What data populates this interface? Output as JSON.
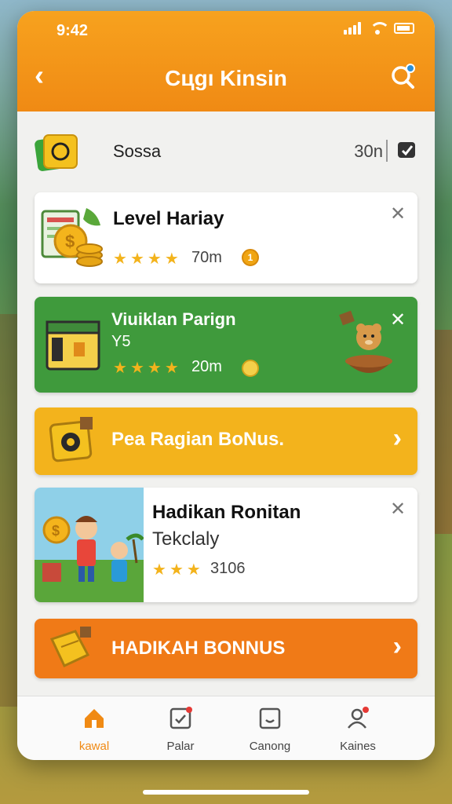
{
  "status": {
    "time": "9:42"
  },
  "header": {
    "title": "Cцgı Kinsin"
  },
  "top_row": {
    "label": "Sossa",
    "count": "30n"
  },
  "cards": [
    {
      "title": "Level Hariay",
      "stars": 4,
      "value": "70m",
      "coin_text": "1"
    },
    {
      "title": "Viuiklan Parign",
      "subtitle": "Y5",
      "stars": 4,
      "value": "20m"
    },
    {
      "title": "Pea Ragian BoNus."
    },
    {
      "title": "Hadikan Ronitan",
      "subtitle": "Tekclaly",
      "stars": 3,
      "value": "3106"
    },
    {
      "title": "HADIKAH BONNUS"
    }
  ],
  "nav": [
    {
      "label": "kawal",
      "active": true
    },
    {
      "label": "Palar"
    },
    {
      "label": "Canong"
    },
    {
      "label": "Kaines"
    }
  ],
  "colors": {
    "orange": "#f08a14",
    "green": "#3f9a3c",
    "yellow": "#f3b31c",
    "deep_orange": "#f07a17"
  }
}
